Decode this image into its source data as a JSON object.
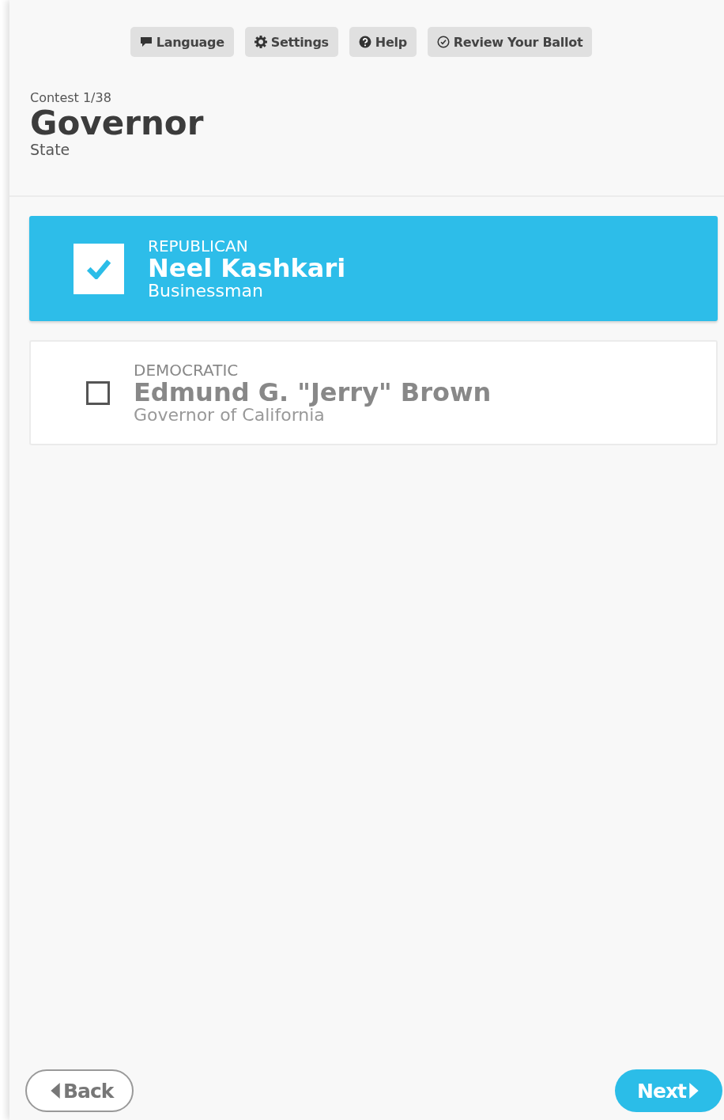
{
  "toolbar": [
    {
      "kind": "language",
      "label": "Language"
    },
    {
      "kind": "settings",
      "label": "Settings"
    },
    {
      "kind": "help",
      "label": "Help"
    },
    {
      "kind": "review",
      "label": "Review Your Ballot"
    }
  ],
  "contest": {
    "counter": "Contest 1/38",
    "title": "Governor",
    "district": "State"
  },
  "candidates": [
    {
      "party": "REPUBLICAN",
      "name": "Neel Kashkari",
      "occupation": "Businessman",
      "selected": true
    },
    {
      "party": "DEMOCRATIC",
      "name": "Edmund G. \"Jerry\" Brown",
      "occupation": "Governor of California",
      "selected": false
    }
  ],
  "nav": {
    "back": "Back",
    "next": "Next"
  }
}
